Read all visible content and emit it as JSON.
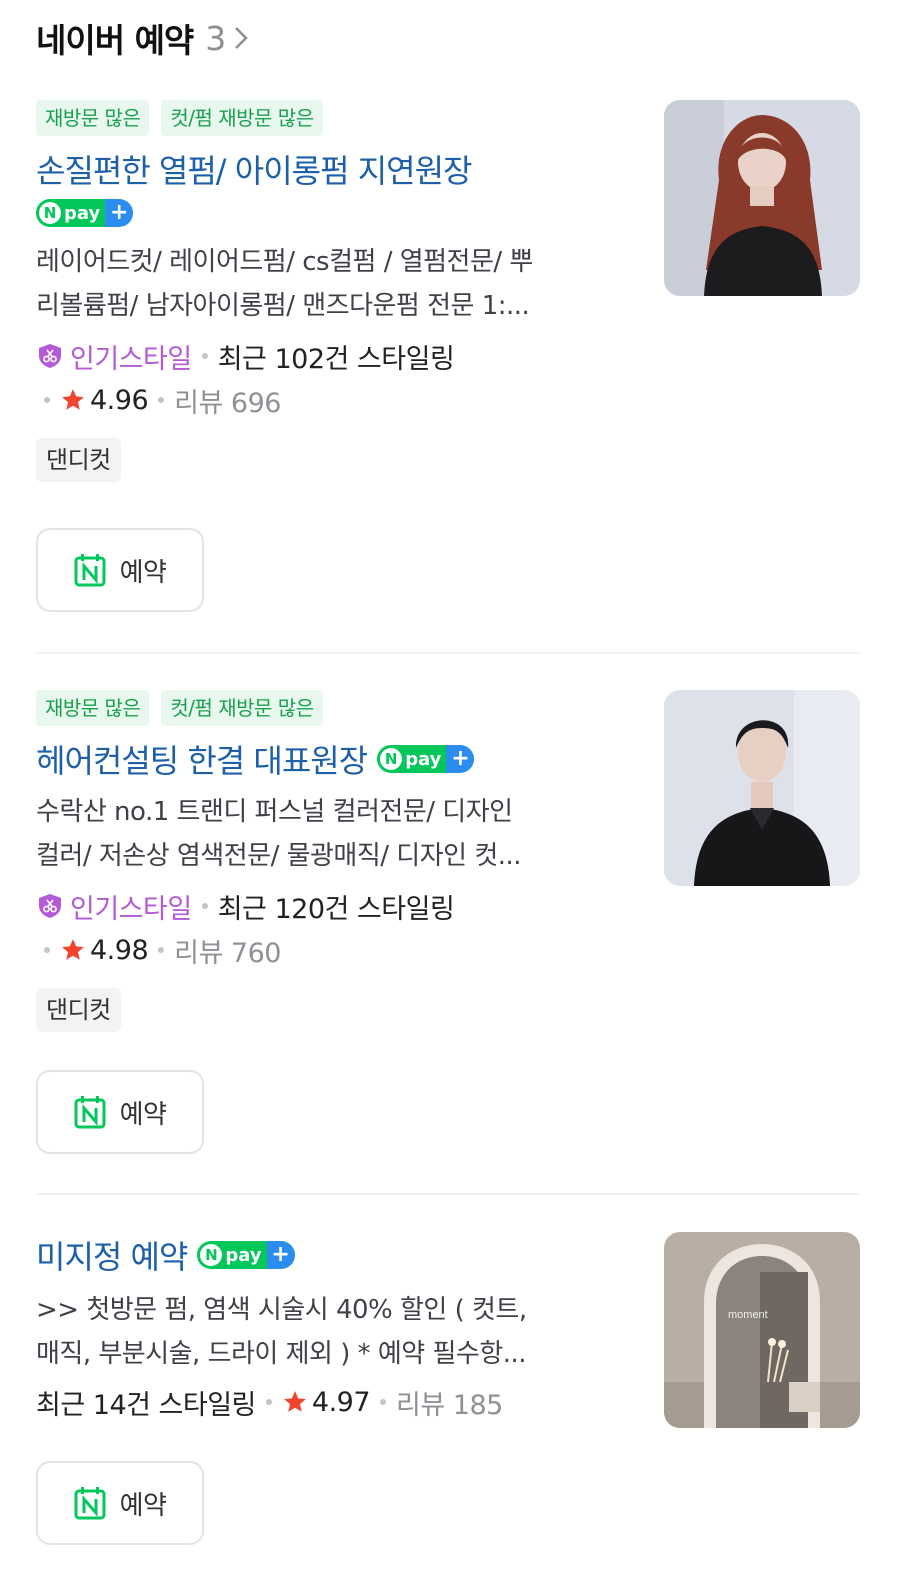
{
  "header": {
    "title": "네이버 예약",
    "count": "3"
  },
  "items": [
    {
      "tags": [
        "재방문 많은",
        "컷/펌 재방문 많은"
      ],
      "name": "손질편한 열펌/ 아이롱펌 지연원장",
      "npay": {
        "n": "N",
        "text": "pay",
        "plus": "+"
      },
      "desc": [
        "레이어드컷/ 레이어드펌/ cs컬펌 / 열펌전문/ 뿌",
        "리볼륨펌/ 남자아이롱펌/ 맨즈다운펌 전문 1:..."
      ],
      "popular": "인기스타일",
      "recent": "최근 102건 스타일링",
      "rating": "4.96",
      "review": "리뷰 696",
      "chip": "댄디컷",
      "book": "예약",
      "image": "woman-long-red-hair-portrait"
    },
    {
      "tags": [
        "재방문 많은",
        "컷/펌 재방문 많은"
      ],
      "name": "헤어컨설팅 한결 대표원장",
      "npay": {
        "n": "N",
        "text": "pay",
        "plus": "+"
      },
      "desc": [
        "수락산 no.1 트랜디 퍼스널 컬러전문/ 디자인",
        "컬러/ 저손상 염색전문/ 물광매직/ 디자인 컷..."
      ],
      "popular": "인기스타일",
      "recent": "최근 120건 스타일링",
      "rating": "4.98",
      "review": "리뷰 760",
      "chip": "댄디컷",
      "book": "예약",
      "image": "man-black-shirt-portrait"
    },
    {
      "name": "미지정 예약",
      "npay": {
        "n": "N",
        "text": "pay",
        "plus": "+"
      },
      "desc": [
        ">> 첫방문 펌, 염색 시술시 40% 할인 ( 컷트,",
        "매직, 부분시술, 드라이 제외 ) * 예약 필수항..."
      ],
      "recent": "최근 14건 스타일링",
      "rating": "4.97",
      "review": "리뷰 185",
      "book": "예약",
      "image": "salon-arched-mirror",
      "image_text": "moment"
    }
  ],
  "colors": {
    "name": "#1d5fa8",
    "tag": "#1aa04f",
    "popular": "#b45ad6",
    "star": "#f0442e",
    "npay": "#03c75a"
  }
}
